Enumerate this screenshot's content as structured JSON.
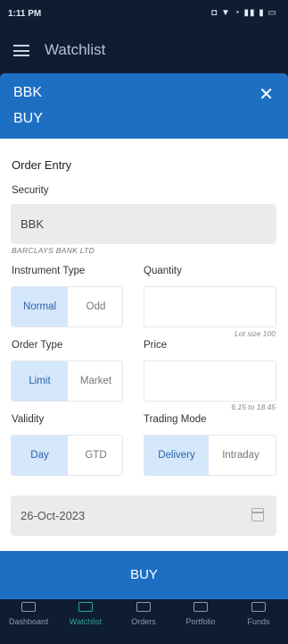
{
  "status_bar": {
    "time": "1:11 PM",
    "icons": "◘ ▼ ◔ ▮▮ ▮ ▭"
  },
  "header": {
    "title": "Watchlist"
  },
  "modal": {
    "symbol": "BBK",
    "side": "BUY",
    "close_glyph": "✕"
  },
  "form": {
    "section_title": "Order Entry",
    "security": {
      "label": "Security",
      "value": "BBK",
      "subtitle": "BARCLAYS BANK LTD"
    },
    "instrument_type": {
      "label": "Instrument Type",
      "options": [
        "Normal",
        "Odd"
      ],
      "selected": "Normal"
    },
    "quantity": {
      "label": "Quantity",
      "value": "",
      "hint": "Lot size 100"
    },
    "order_type": {
      "label": "Order Type",
      "options": [
        "Limit",
        "Market"
      ],
      "selected": "Limit"
    },
    "price": {
      "label": "Price",
      "value": "",
      "hint": "6.15 to 18.45"
    },
    "validity": {
      "label": "Validity",
      "options": [
        "Day",
        "GTD"
      ],
      "selected": "Day"
    },
    "trading_mode": {
      "label": "Trading Mode",
      "options": [
        "Delivery",
        "Intraday"
      ],
      "selected": "Delivery"
    },
    "date": {
      "value": "26-Oct-2023",
      "icon": "calendar-icon"
    }
  },
  "buy_button": {
    "label": "BUY"
  },
  "bottom_nav": {
    "items": [
      {
        "label": "Dashboard",
        "icon": "dashboard-icon"
      },
      {
        "label": "Watchlist",
        "icon": "watchlist-icon"
      },
      {
        "label": "Orders",
        "icon": "orders-icon"
      },
      {
        "label": "Portfolio",
        "icon": "portfolio-icon"
      },
      {
        "label": "Funds",
        "icon": "funds-icon"
      }
    ],
    "active": "Watchlist"
  },
  "colors": {
    "primary": "#1d6fc4",
    "dark_bg": "#0f1d33",
    "selected_bg": "#d5e7fb",
    "active_nav": "#2fa39b"
  }
}
